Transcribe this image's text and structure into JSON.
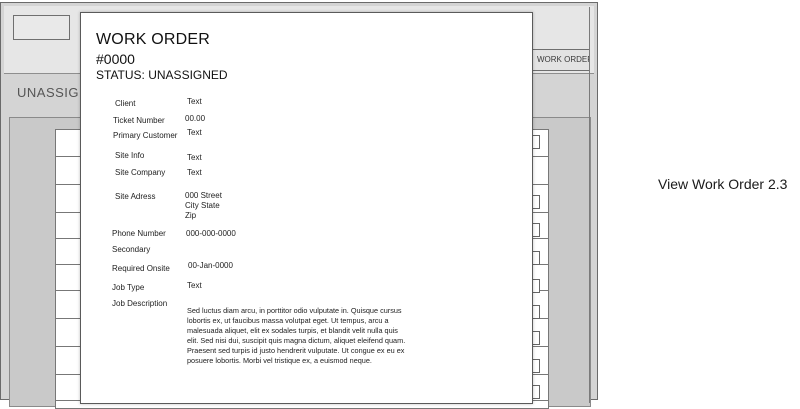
{
  "background": {
    "button_label": "WORK ORDER",
    "heading": "UNASSIGN"
  },
  "modal": {
    "title": "WORK ORDER",
    "number": "#0000",
    "status": "STATUS: UNASSIGNED",
    "fields": {
      "client": {
        "label": "Client",
        "value": "Text"
      },
      "ticket_number": {
        "label": "Ticket Number",
        "value": "00.00"
      },
      "primary_customer": {
        "label": "Primary Customer",
        "value": "Text"
      },
      "site_info": {
        "label": "Site Info",
        "value": "Text"
      },
      "site_company": {
        "label": "Site Company",
        "value": "Text"
      },
      "site_address": {
        "label": "Site Adress",
        "lines": [
          "000 Street",
          "City State",
          "Zip"
        ]
      },
      "phone_number": {
        "label": "Phone Number",
        "value": "000-000-0000"
      },
      "secondary": {
        "label": "Secondary",
        "value": ""
      },
      "required_onsite": {
        "label": "Required Onsite",
        "value": "00-Jan-0000"
      },
      "job_type": {
        "label": "Job Type",
        "value": "Text"
      },
      "job_description": {
        "label": "Job Description",
        "value": "Sed luctus diam arcu, in porttitor odio vulputate in. Quisque cursus lobortis ex, ut faucibus massa volutpat eget. Ut tempus, arcu a malesuada aliquet, elit ex sodales turpis, et blandit velit nulla quis elit. Sed nisi dui, suscipit quis magna dictum, aliquet eleifend quam. Praesent sed turpis id justo hendrerit vulputate. Ut congue ex eu ex posuere lobortis. Morbi vel tristique ex, a euismod neque."
      }
    }
  },
  "caption": "View Work Order 2.3"
}
